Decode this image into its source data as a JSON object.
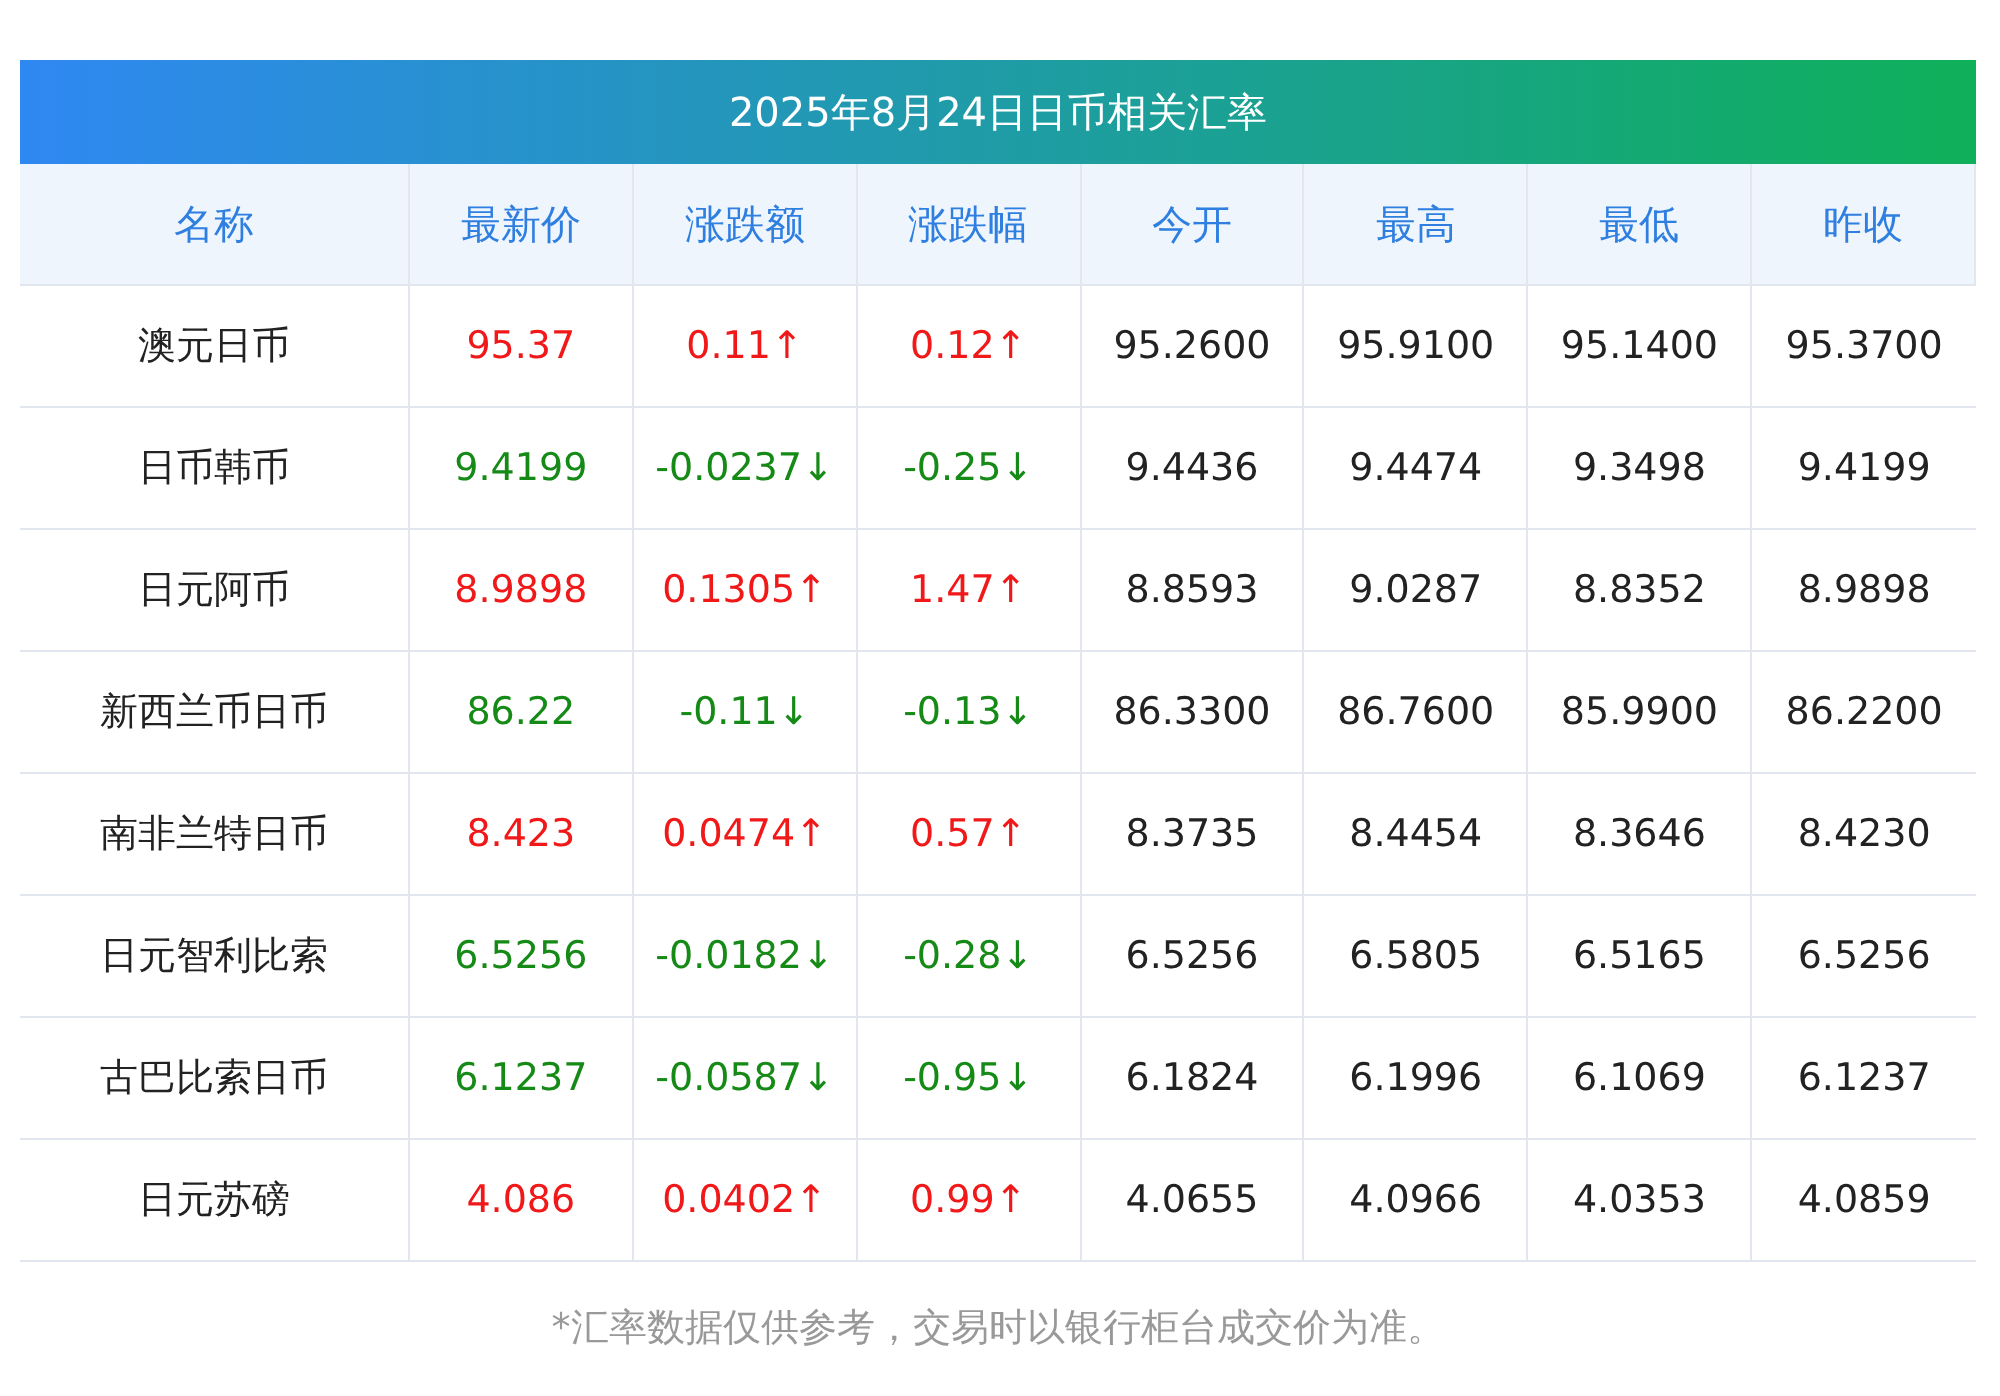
{
  "title": "2025年8月24日日币相关汇率",
  "columns": [
    "名称",
    "最新价",
    "涨跌额",
    "涨跌幅",
    "今开",
    "最高",
    "最低",
    "昨收"
  ],
  "rows": [
    {
      "rising": true,
      "cells": [
        "澳元日币",
        "95.37",
        "0.11↑",
        "0.12↑",
        "95.2600",
        "95.9100",
        "95.1400",
        "95.3700"
      ]
    },
    {
      "rising": false,
      "cells": [
        "日币韩币",
        "9.4199",
        "-0.0237↓",
        "-0.25↓",
        "9.4436",
        "9.4474",
        "9.3498",
        "9.4199"
      ]
    },
    {
      "rising": true,
      "cells": [
        "日元阿币",
        "8.9898",
        "0.1305↑",
        "1.47↑",
        "8.8593",
        "9.0287",
        "8.8352",
        "8.9898"
      ]
    },
    {
      "rising": false,
      "cells": [
        "新西兰币日币",
        "86.22",
        "-0.11↓",
        "-0.13↓",
        "86.3300",
        "86.7600",
        "85.9900",
        "86.2200"
      ]
    },
    {
      "rising": true,
      "cells": [
        "南非兰特日币",
        "8.423",
        "0.0474↑",
        "0.57↑",
        "8.3735",
        "8.4454",
        "8.3646",
        "8.4230"
      ]
    },
    {
      "rising": false,
      "cells": [
        "日元智利比索",
        "6.5256",
        "-0.0182↓",
        "-0.28↓",
        "6.5256",
        "6.5805",
        "6.5165",
        "6.5256"
      ]
    },
    {
      "rising": false,
      "cells": [
        "古巴比索日币",
        "6.1237",
        "-0.0587↓",
        "-0.95↓",
        "6.1824",
        "6.1996",
        "6.1069",
        "6.1237"
      ]
    },
    {
      "rising": true,
      "cells": [
        "日元苏磅",
        "4.086",
        "0.0402↑",
        "0.99↑",
        "4.0655",
        "4.0966",
        "4.0353",
        "4.0859"
      ]
    }
  ],
  "footnote": "*汇率数据仅供参考，交易时以银行柜台成交价为准。"
}
